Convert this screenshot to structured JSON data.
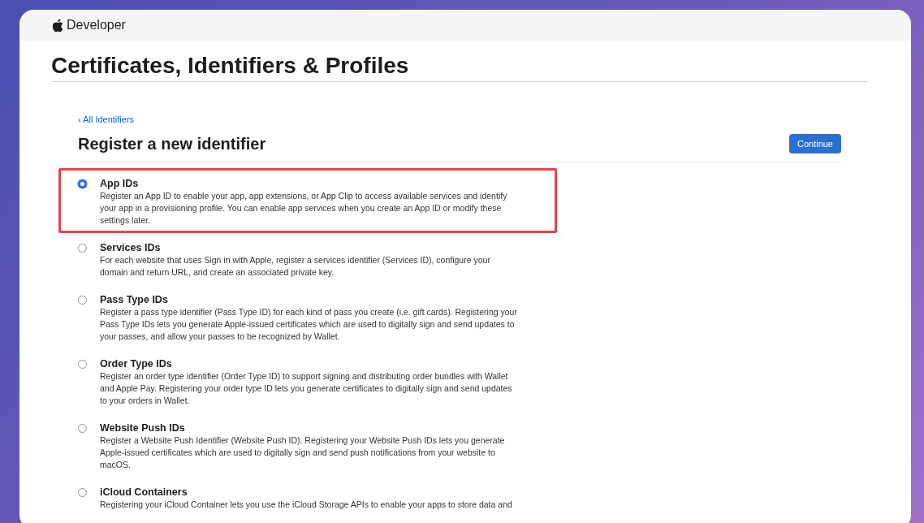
{
  "header": {
    "brand": "Developer"
  },
  "page_title": "Certificates, Identifiers & Profiles",
  "back_link": "‹ All Identifiers",
  "heading": "Register a new identifier",
  "continue_button": "Continue",
  "options": [
    {
      "title": "App IDs",
      "description": "Register an App ID to enable your app, app extensions, or App Clip to access available services and identify your app in a provisioning profile. You can enable app services when you create an App ID or modify these settings later.",
      "selected": true,
      "highlighted": true
    },
    {
      "title": "Services IDs",
      "description": "For each website that uses Sign in with Apple, register a services identifier (Services ID), configure your domain and return URL, and create an associated private key.",
      "selected": false,
      "highlighted": false
    },
    {
      "title": "Pass Type IDs",
      "description": "Register a pass type identifier (Pass Type ID) for each kind of pass you create (i.e. gift cards). Registering your Pass Type IDs lets you generate Apple-issued certificates which are used to digitally sign and send updates to your passes, and allow your passes to be recognized by Wallet.",
      "selected": false,
      "highlighted": false
    },
    {
      "title": "Order Type IDs",
      "description": "Register an order type identifier (Order Type ID) to support signing and distributing order bundles with Wallet and Apple Pay. Registering your order type ID lets you generate certificates to digitally sign and send updates to your orders in Wallet.",
      "selected": false,
      "highlighted": false
    },
    {
      "title": "Website Push IDs",
      "description": "Register a Website Push Identifier (Website Push ID). Registering your Website Push IDs lets you generate Apple-issued certificates which are used to digitally sign and send push notifications from your website to macOS.",
      "selected": false,
      "highlighted": false
    },
    {
      "title": "iCloud Containers",
      "description": "Registering your iCloud Container lets you use the iCloud Storage APIs to enable your apps to store data and",
      "selected": false,
      "highlighted": false
    }
  ]
}
